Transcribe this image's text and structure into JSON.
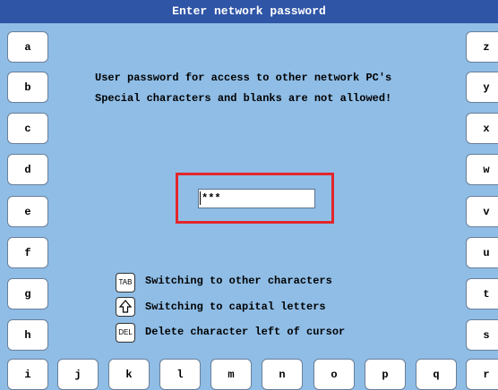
{
  "window": {
    "title": "Enter network password"
  },
  "messages": {
    "line1": "User password for access to other network PC's",
    "line2": "Special characters and blanks are not allowed!"
  },
  "password_field": {
    "value": "***"
  },
  "hints": [
    {
      "icon": "TAB",
      "text": "Switching to other characters"
    },
    {
      "icon": "shift-arrow",
      "text": "Switching to capital letters"
    },
    {
      "icon": "DEL",
      "text": "Delete character left of cursor"
    }
  ],
  "keys": {
    "left": [
      "a",
      "b",
      "c",
      "d",
      "e",
      "f",
      "g",
      "h",
      "i"
    ],
    "right": [
      "z",
      "y",
      "x",
      "w",
      "v",
      "u",
      "t",
      "s",
      "r"
    ],
    "bottom": [
      "j",
      "k",
      "l",
      "m",
      "n",
      "o",
      "p",
      "q"
    ]
  },
  "colors": {
    "title_bar": "#2f55a7",
    "background": "#8fbde6",
    "highlight": "#e3262c"
  }
}
